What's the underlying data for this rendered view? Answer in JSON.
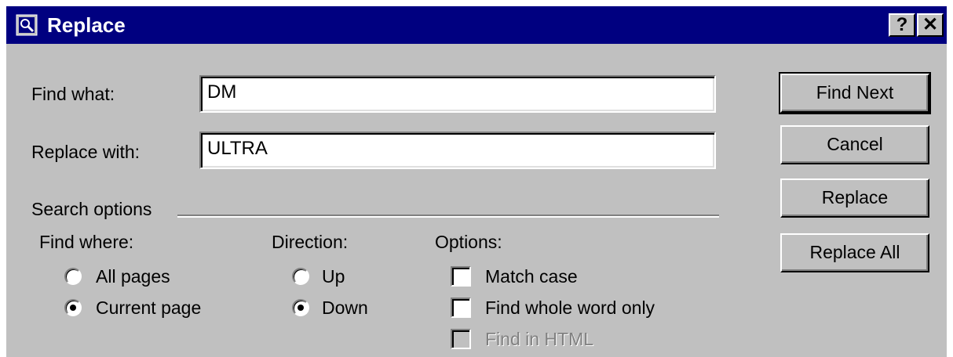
{
  "window": {
    "title": "Replace",
    "help_label": "?",
    "close_label": "✕"
  },
  "fields": {
    "find_label": "Find what:",
    "find_value": "DM",
    "replace_label": "Replace with:",
    "replace_value": "ULTRA"
  },
  "buttons": {
    "find_next": "Find Next",
    "cancel": "Cancel",
    "replace": "Replace",
    "replace_all": "Replace All"
  },
  "search_options": {
    "group_label": "Search options",
    "find_where": {
      "label": "Find where:",
      "options": [
        {
          "label": "All pages",
          "selected": false
        },
        {
          "label": "Current page",
          "selected": true
        }
      ]
    },
    "direction": {
      "label": "Direction:",
      "options": [
        {
          "label": "Up",
          "selected": false
        },
        {
          "label": "Down",
          "selected": true
        }
      ]
    },
    "options": {
      "label": "Options:",
      "items": [
        {
          "label": "Match case",
          "checked": false,
          "enabled": true
        },
        {
          "label": "Find whole word only",
          "checked": false,
          "enabled": true
        },
        {
          "label": "Find in HTML",
          "checked": false,
          "enabled": false
        }
      ]
    }
  },
  "colors": {
    "titlebar": "#000080",
    "face": "#c0c0c0"
  }
}
